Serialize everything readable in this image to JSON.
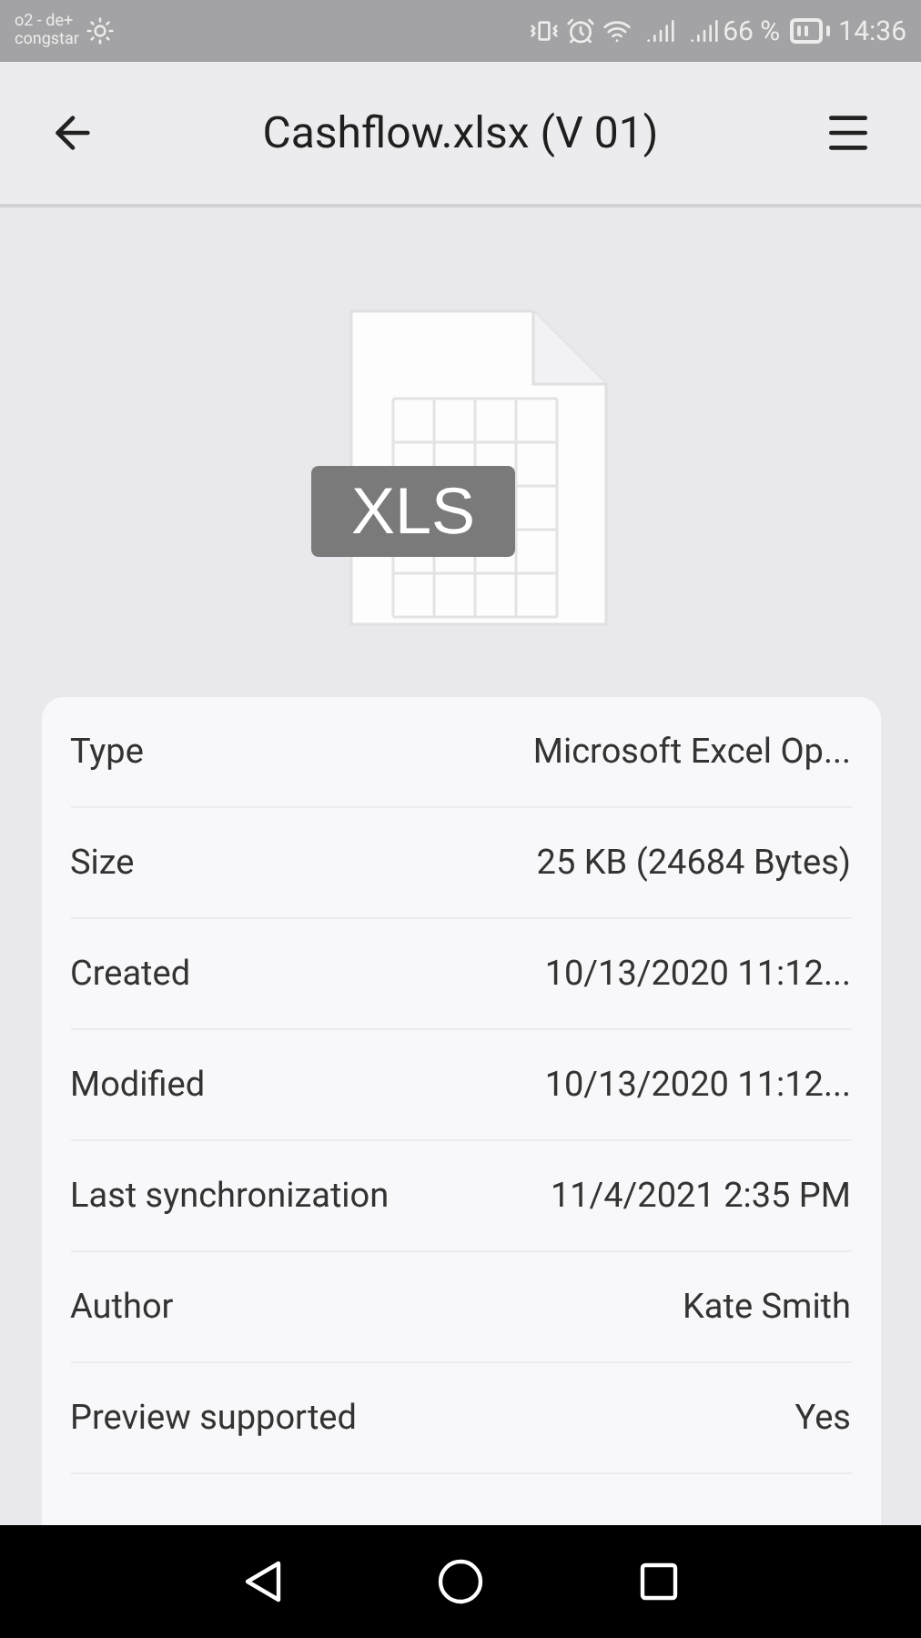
{
  "status_bar": {
    "carrier": [
      "o2 - de+",
      "congstar"
    ],
    "battery_percent": "66 %",
    "time": "14:36"
  },
  "header": {
    "title": "Cashflow.xlsx (V 01)"
  },
  "file_icon": {
    "label": "XLS"
  },
  "details": [
    {
      "label": "Type",
      "value": "Microsoft Excel Op..."
    },
    {
      "label": "Size",
      "value": "25 KB (24684 Bytes)"
    },
    {
      "label": "Created",
      "value": "10/13/2020 11:12..."
    },
    {
      "label": "Modified",
      "value": "10/13/2020 11:12..."
    },
    {
      "label": "Last synchronization",
      "value": "11/4/2021 2:35 PM"
    },
    {
      "label": "Author",
      "value": "Kate Smith"
    },
    {
      "label": "Preview supported",
      "value": "Yes"
    }
  ]
}
